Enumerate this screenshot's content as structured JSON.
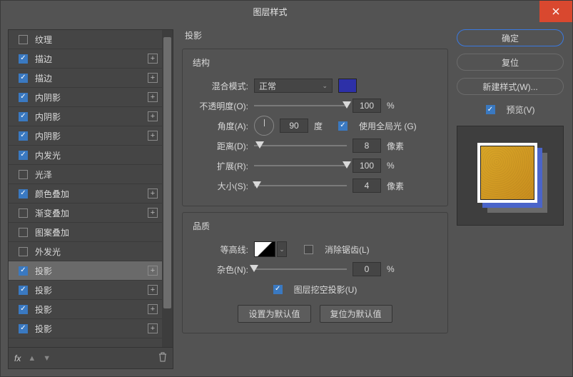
{
  "window": {
    "title": "图层样式"
  },
  "sidebar": {
    "items": [
      {
        "label": "纹理",
        "checked": false,
        "plus": false
      },
      {
        "label": "描边",
        "checked": true,
        "plus": true
      },
      {
        "label": "描边",
        "checked": true,
        "plus": true
      },
      {
        "label": "内阴影",
        "checked": true,
        "plus": true
      },
      {
        "label": "内阴影",
        "checked": true,
        "plus": true
      },
      {
        "label": "内阴影",
        "checked": true,
        "plus": true
      },
      {
        "label": "内发光",
        "checked": true,
        "plus": false
      },
      {
        "label": "光泽",
        "checked": false,
        "plus": false
      },
      {
        "label": "颜色叠加",
        "checked": true,
        "plus": true
      },
      {
        "label": "渐变叠加",
        "checked": false,
        "plus": true
      },
      {
        "label": "图案叠加",
        "checked": false,
        "plus": false
      },
      {
        "label": "外发光",
        "checked": false,
        "plus": false
      },
      {
        "label": "投影",
        "checked": true,
        "plus": true,
        "selected": true
      },
      {
        "label": "投影",
        "checked": true,
        "plus": true
      },
      {
        "label": "投影",
        "checked": true,
        "plus": true
      },
      {
        "label": "投影",
        "checked": true,
        "plus": true
      }
    ],
    "footer_fx": "fx"
  },
  "panel": {
    "title": "投影",
    "structure": {
      "title": "结构",
      "blend_label": "混合模式:",
      "blend_value": "正常",
      "opacity_label": "不透明度(O):",
      "opacity_value": "100",
      "opacity_unit": "%",
      "angle_label": "角度(A):",
      "angle_value": "90",
      "angle_unit": "度",
      "global_light_label": "使用全局光 (G)",
      "distance_label": "距离(D):",
      "distance_value": "8",
      "distance_unit": "像素",
      "spread_label": "扩展(R):",
      "spread_value": "100",
      "spread_unit": "%",
      "size_label": "大小(S):",
      "size_value": "4",
      "size_unit": "像素",
      "shadow_color": "#2d30a8"
    },
    "quality": {
      "title": "品质",
      "contour_label": "等高线:",
      "antialias_label": "消除锯齿(L)",
      "noise_label": "杂色(N):",
      "noise_value": "0",
      "noise_unit": "%"
    },
    "knockout_label": "图层挖空投影(U)",
    "set_default": "设置为默认值",
    "reset_default": "复位为默认值"
  },
  "right": {
    "ok": "确定",
    "cancel": "复位",
    "new_style": "新建样式(W)...",
    "preview": "预览(V)"
  }
}
